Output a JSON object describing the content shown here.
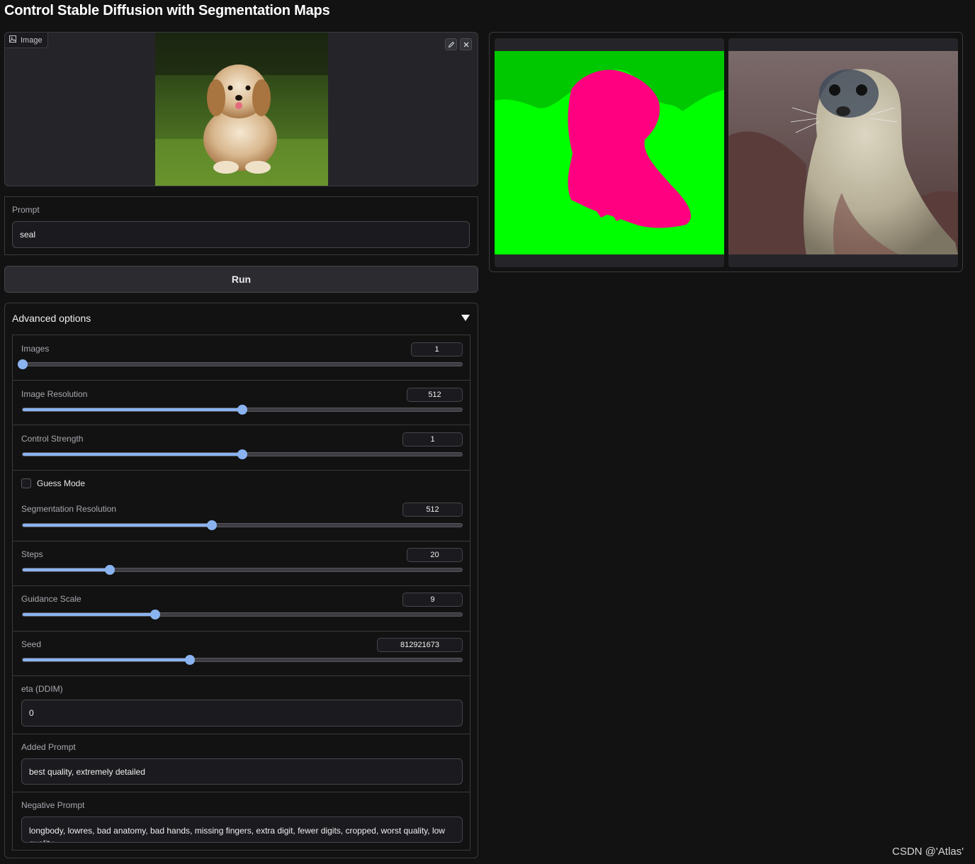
{
  "page": {
    "title": "Control Stable Diffusion with Segmentation Maps"
  },
  "input_image": {
    "label": "Image",
    "icon": "image-icon",
    "edit_icon": "pencil-icon",
    "clear_icon": "close-icon"
  },
  "prompt": {
    "label": "Prompt",
    "value": "seal"
  },
  "run_button": {
    "label": "Run"
  },
  "advanced": {
    "label": "Advanced options",
    "expanded": true,
    "images": {
      "label": "Images",
      "value": "1",
      "level": 0.0
    },
    "image_resolution": {
      "label": "Image Resolution",
      "value": "512",
      "level": 0.5
    },
    "control_strength": {
      "label": "Control Strength",
      "value": "1",
      "level": 0.5
    },
    "guess_mode": {
      "label": "Guess Mode",
      "checked": false
    },
    "segmentation_resolution": {
      "label": "Segmentation Resolution",
      "value": "512",
      "level": 0.43
    },
    "steps": {
      "label": "Steps",
      "value": "20",
      "level": 0.198
    },
    "guidance_scale": {
      "label": "Guidance Scale",
      "value": "9",
      "level": 0.302
    },
    "seed": {
      "label": "Seed",
      "value": "812921673",
      "level": 0.38
    },
    "eta": {
      "label": "eta (DDIM)",
      "value": "0"
    },
    "added_prompt": {
      "label": "Added Prompt",
      "value": "best quality, extremely detailed"
    },
    "negative_prompt": {
      "label": "Negative Prompt",
      "value": "longbody, lowres, bad anatomy, bad hands, missing fingers, extra digit, fewer digits, cropped, worst quality, low quality"
    }
  },
  "gallery": {
    "items": [
      "segmentation-map",
      "seal-result"
    ]
  },
  "watermark": "CSDN @'Atlas'",
  "colors": {
    "accent": "#8ab4f0",
    "background": "#121212",
    "segment_green": "#00ff00",
    "segment_pink": "#ff0080"
  }
}
